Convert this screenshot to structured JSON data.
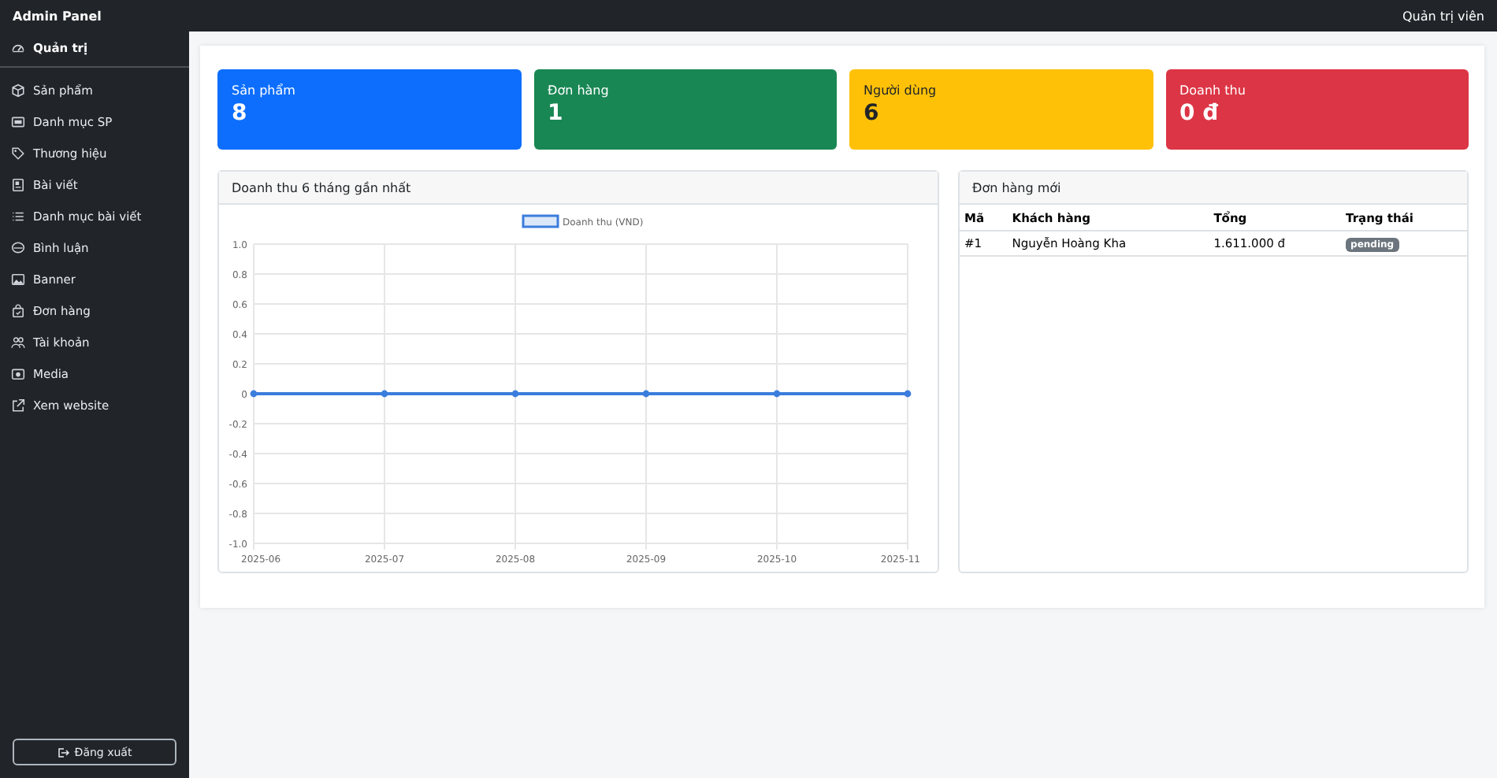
{
  "topbar": {
    "brand": "Admin Panel",
    "user": "Quản trị viên"
  },
  "sidebar": {
    "groups": [
      [
        {
          "label": "Quản trị",
          "selected": true
        }
      ],
      [
        {
          "label": "Sản phẩm",
          "selected": false
        },
        {
          "label": "Danh mục SP",
          "selected": false
        },
        {
          "label": "Thương hiệu",
          "selected": false
        },
        {
          "label": "Bài viết",
          "selected": false
        },
        {
          "label": "Danh mục bài viết",
          "selected": false
        },
        {
          "label": "Bình luận",
          "selected": false
        },
        {
          "label": "Banner",
          "selected": false
        },
        {
          "label": "Đơn hàng",
          "selected": false
        },
        {
          "label": "Tài khoản",
          "selected": false
        },
        {
          "label": "Media",
          "selected": false
        },
        {
          "label": "Xem website",
          "selected": false
        }
      ]
    ],
    "logout": "Đăng xuất"
  },
  "stats": [
    {
      "label": "Sản phẩm",
      "value": "8",
      "color": "#0d6efd"
    },
    {
      "label": "Đơn hàng",
      "value": "1",
      "color": "#198754"
    },
    {
      "label": "Người dùng",
      "value": "6",
      "color": "#ffc107"
    },
    {
      "label": "Doanh thu",
      "value": "0 đ",
      "color": "#dc3545"
    }
  ],
  "revenue_panel": {
    "title": "Doanh thu 6 tháng gần nhất",
    "chart_data": {
      "type": "line",
      "categories": [
        "2025-06",
        "2025-07",
        "2025-08",
        "2025-09",
        "2025-10",
        "2025-11"
      ],
      "series": [
        {
          "name": "Doanh thu (VND)",
          "color": "#3b7ddd",
          "marker": "circle",
          "values": [
            0,
            0,
            0,
            0,
            0,
            0
          ]
        }
      ],
      "grid": true,
      "ylim": [
        -1,
        1
      ],
      "yticks": [
        {
          "value": 1,
          "label": "1.0"
        },
        {
          "value": 0.8,
          "label": "0.8"
        },
        {
          "value": 0.6,
          "label": "0.6"
        },
        {
          "value": 0.4,
          "label": "0.4"
        },
        {
          "value": 0.2,
          "label": "0.2"
        },
        {
          "value": 0,
          "label": "0"
        },
        {
          "value": -0.2,
          "label": "-0.2"
        },
        {
          "value": -0.4,
          "label": "-0.4"
        },
        {
          "value": -0.6,
          "label": "-0.6"
        },
        {
          "value": -0.8,
          "label": "-0.8"
        },
        {
          "value": -1,
          "label": "-1.0"
        }
      ]
    }
  },
  "orders_panel": {
    "title": "Đơn hàng mới",
    "columns": [
      "Mã",
      "Khách hàng",
      "Tổng",
      "Trạng thái"
    ],
    "rows": [
      {
        "id": "#1",
        "customer": "Nguyễn Hoàng Kha",
        "total": "1.611.000 đ",
        "status": "pending"
      }
    ]
  }
}
